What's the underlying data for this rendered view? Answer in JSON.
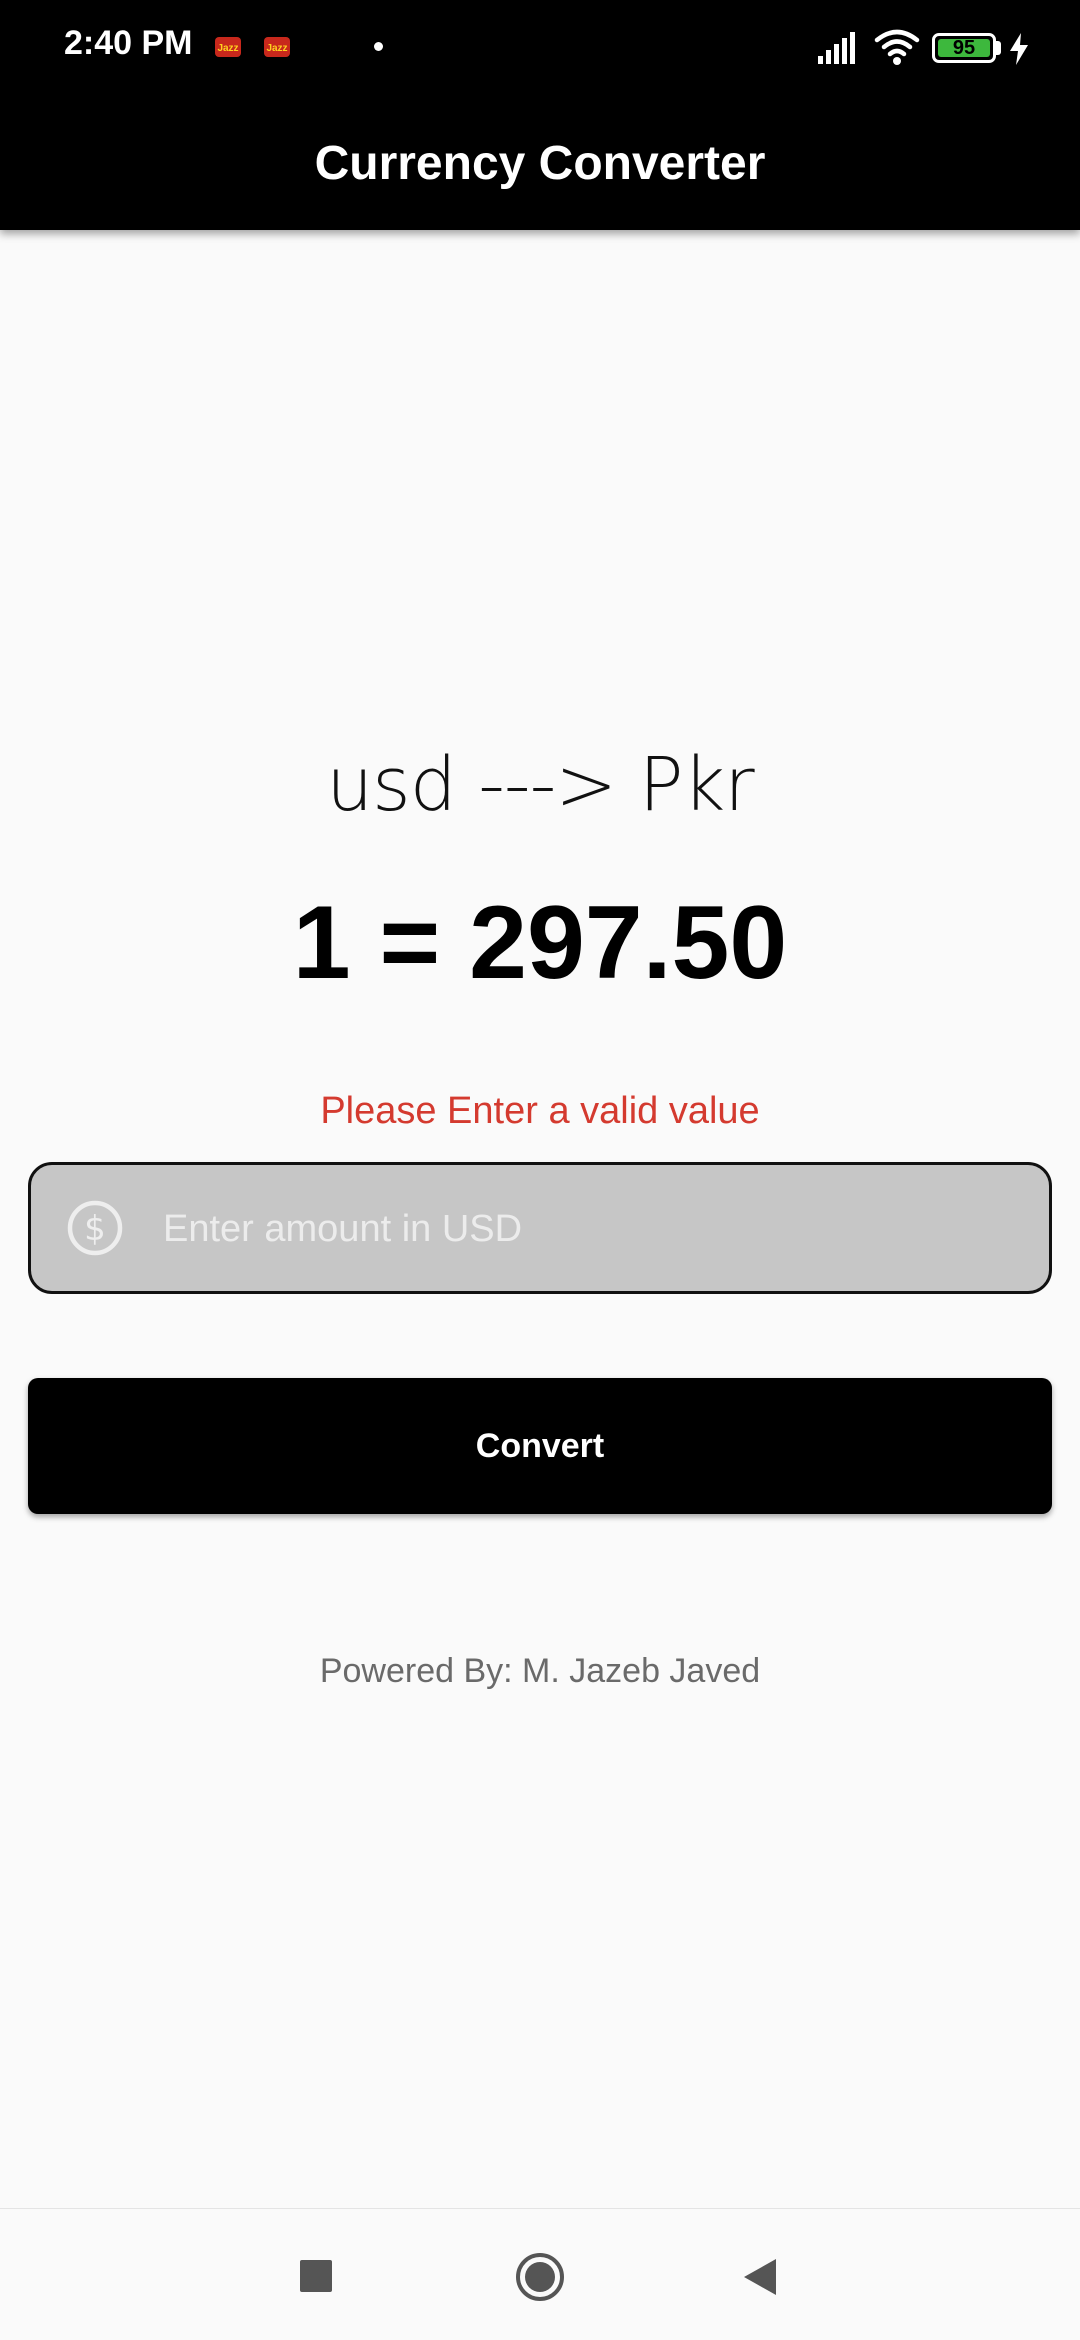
{
  "status_bar": {
    "time": "2:40 PM",
    "battery_level": "95",
    "notification_icons": [
      "jazz-icon",
      "jazz-icon"
    ]
  },
  "app_bar": {
    "title": "Currency Converter"
  },
  "converter": {
    "pair_label": "usd ---> Pkr",
    "rate_text": "1 = 297.50",
    "error_message": "Please Enter a valid value",
    "amount_placeholder": "Enter amount in USD",
    "amount_value": "",
    "convert_label": "Convert",
    "powered_by": "Powered By: M. Jazeb Javed"
  },
  "colors": {
    "app_bar": "#000000",
    "error": "#d43a2f",
    "field_fill": "#c6c6c6",
    "button": "#000000",
    "background": "#fafafa"
  }
}
